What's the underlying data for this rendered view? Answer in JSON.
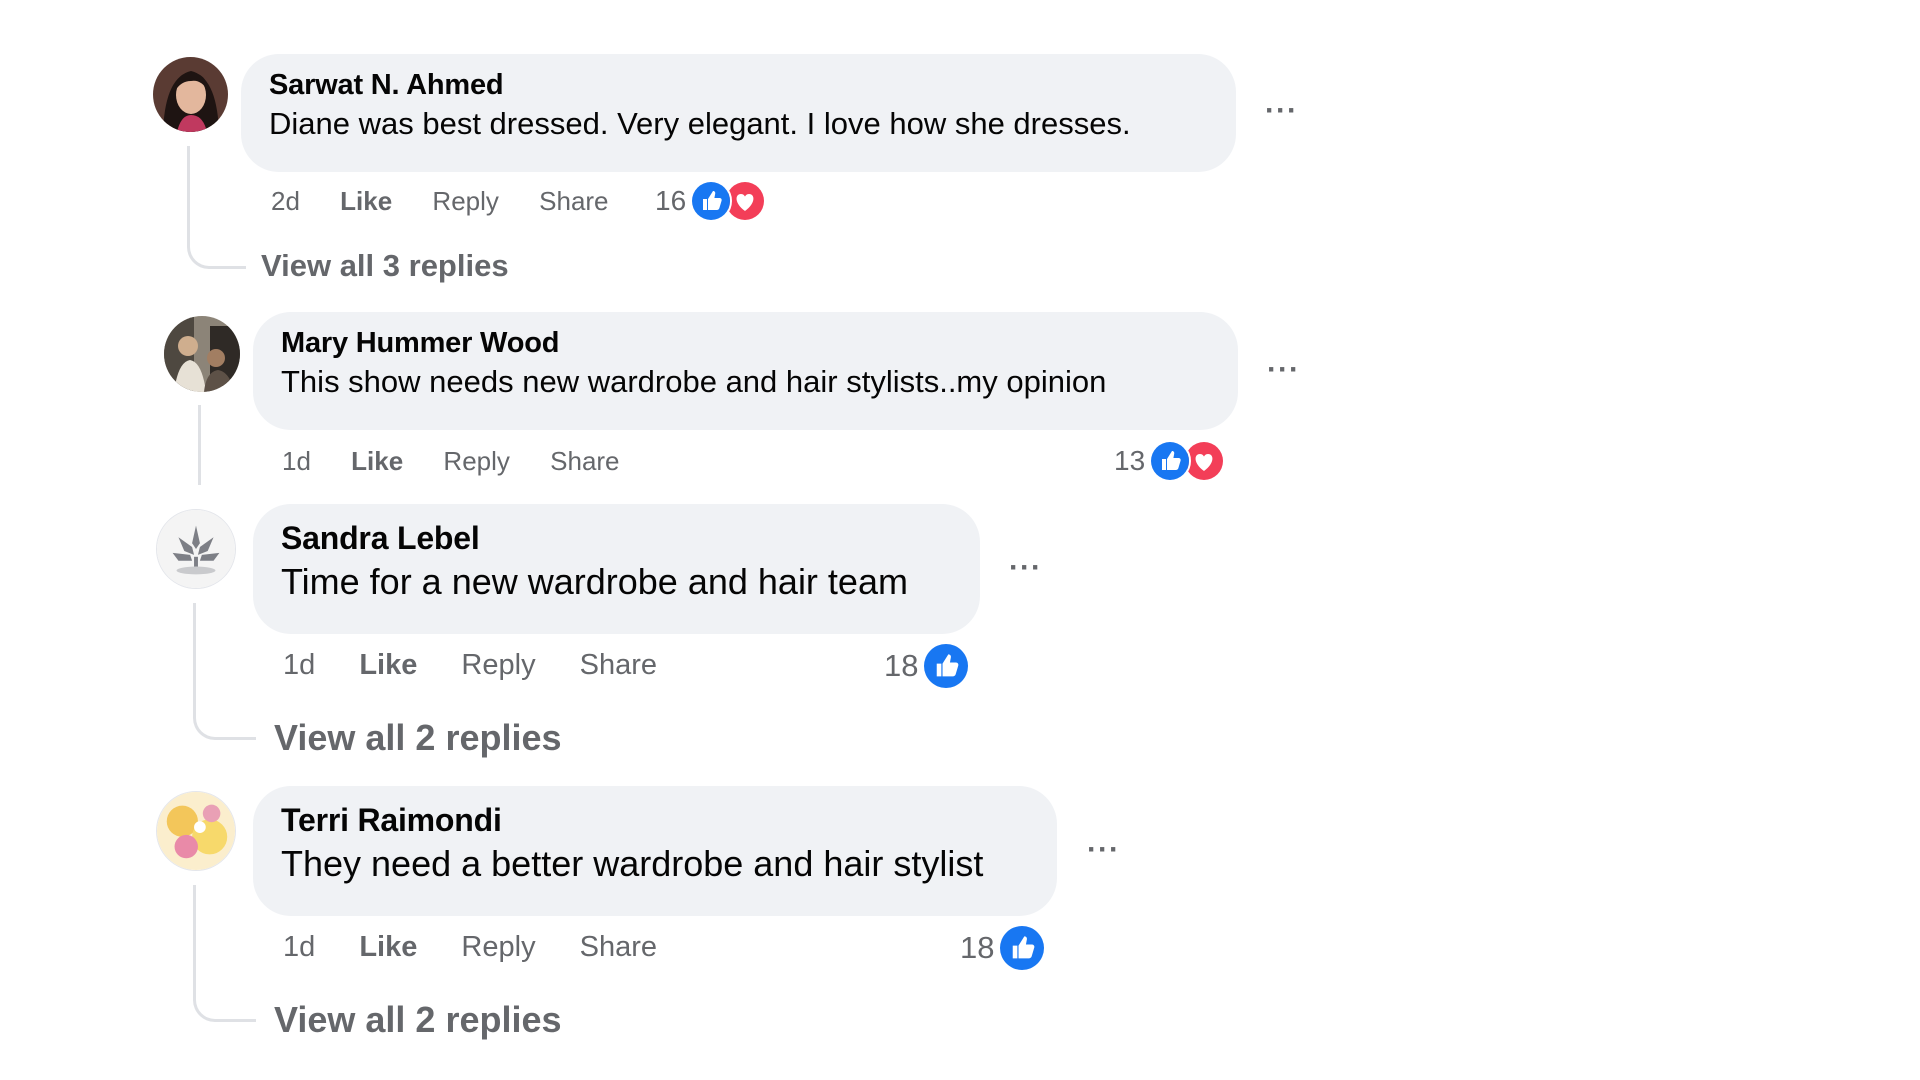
{
  "comments": [
    {
      "author": "Sarwat N. Ahmed",
      "text": "Diane was best dressed. Very elegant. I love how she dresses.",
      "age": "2d",
      "like_label": "Like",
      "reply_label": "Reply",
      "share_label": "Share",
      "reaction_count": "16",
      "reactions": [
        "like-icon",
        "love-icon"
      ],
      "view_replies": "View all 3 replies",
      "more_label": "···"
    },
    {
      "author": "Mary Hummer Wood",
      "text": "This show needs new wardrobe and hair stylists..my opinion",
      "age": "1d",
      "like_label": "Like",
      "reply_label": "Reply",
      "share_label": "Share",
      "reaction_count": "13",
      "reactions": [
        "like-icon",
        "love-icon"
      ],
      "more_label": "···"
    },
    {
      "author": "Sandra Lebel",
      "text": "Time for a new wardrobe and hair team",
      "age": "1d",
      "like_label": "Like",
      "reply_label": "Reply",
      "share_label": "Share",
      "reaction_count": "18",
      "reactions": [
        "like-icon"
      ],
      "view_replies": "View all 2 replies",
      "more_label": "···"
    },
    {
      "author": "Terri Raimondi",
      "text": "They need a better wardrobe and hair stylist",
      "age": "1d",
      "like_label": "Like",
      "reply_label": "Reply",
      "share_label": "Share",
      "reaction_count": "18",
      "reactions": [
        "like-icon"
      ],
      "view_replies": "View all 2 replies",
      "more_label": "···"
    }
  ],
  "colors": {
    "bubble_bg": "#f0f2f5",
    "meta_text": "#65676b",
    "like_blue": "#1877f2",
    "love_red": "#f33e58",
    "thread_line": "#dfe1e5"
  }
}
